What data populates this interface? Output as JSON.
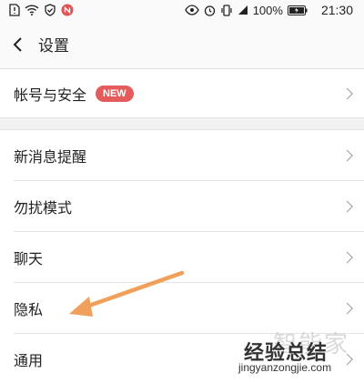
{
  "status_bar": {
    "time": "21:30",
    "battery": "100%",
    "left_icons": [
      "sim-alert-icon",
      "wifi-icon",
      "shield-check-icon",
      "app-notification-icon"
    ],
    "right_icons": [
      "eye-icon",
      "alarm-icon",
      "vibrate-icon",
      "signal-icon",
      "battery-icon"
    ]
  },
  "header": {
    "title": "设置",
    "back_icon": "chevron-left-icon"
  },
  "sections": {
    "account": {
      "label": "帐号与安全",
      "badge": "NEW"
    },
    "items": [
      {
        "label": "新消息提醒"
      },
      {
        "label": "勿扰模式"
      },
      {
        "label": "聊天"
      },
      {
        "label": "隐私"
      },
      {
        "label": "通用"
      }
    ]
  },
  "annotation": {
    "arrow_color": "#f0a05a"
  },
  "watermark": {
    "ghost": "智能家",
    "title": "经验总结",
    "url": "jingyanzongjie.com"
  }
}
